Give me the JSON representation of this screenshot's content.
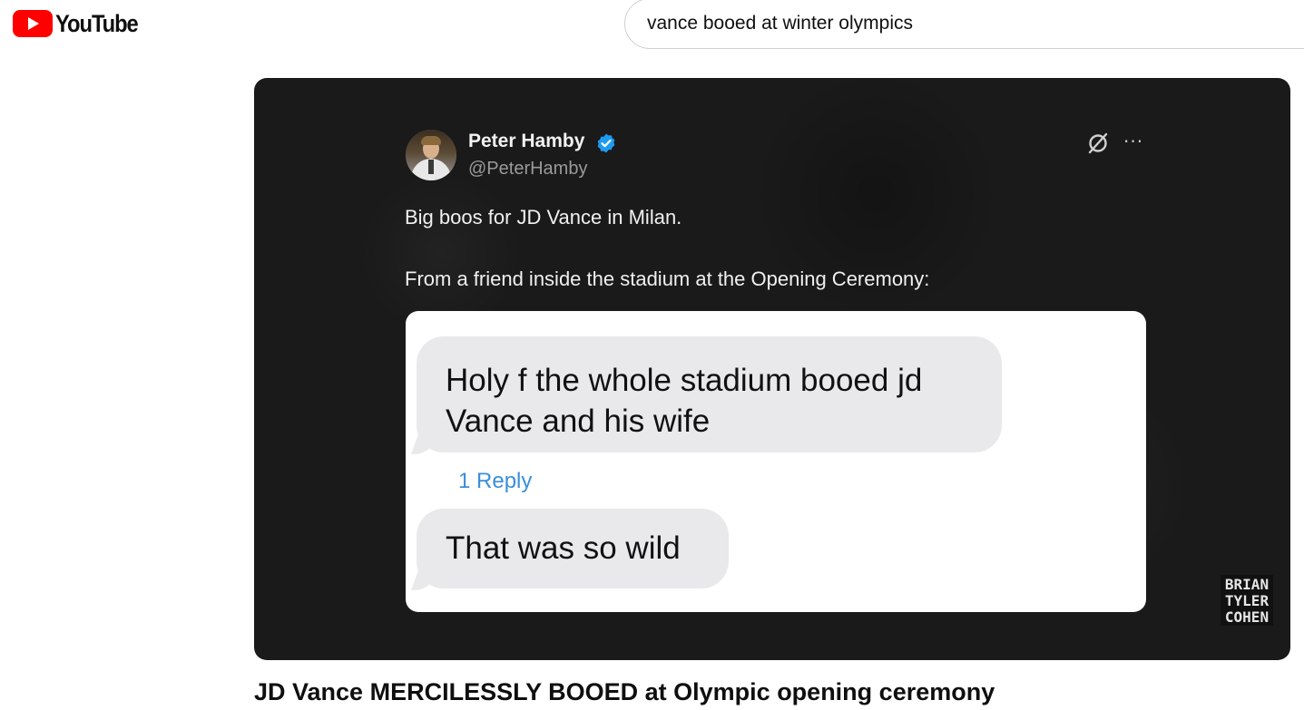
{
  "header": {
    "logo_text": "YouTube",
    "search_query": "vance booed at winter olympics"
  },
  "video": {
    "title": "JD Vance MERCILESSLY BOOED at Olympic opening ceremony",
    "watermark": [
      "BRIAN",
      "TYLER",
      "COHEN"
    ],
    "tweet": {
      "author_name": "Peter Hamby",
      "author_handle": "@PeterHamby",
      "text_line1": "Big boos for JD Vance in Milan.",
      "text_line2": "From a friend inside the stadium at the Opening Ceremony:",
      "more_glyph": "···",
      "messages": [
        "Holy f the whole stadium booed jd Vance and his wife",
        "That was so wild"
      ],
      "reply_link": "1 Reply"
    }
  },
  "colors": {
    "brand_red": "#ff0000",
    "verified_blue": "#1d9bf0",
    "reply_blue": "#3b8fd9"
  }
}
